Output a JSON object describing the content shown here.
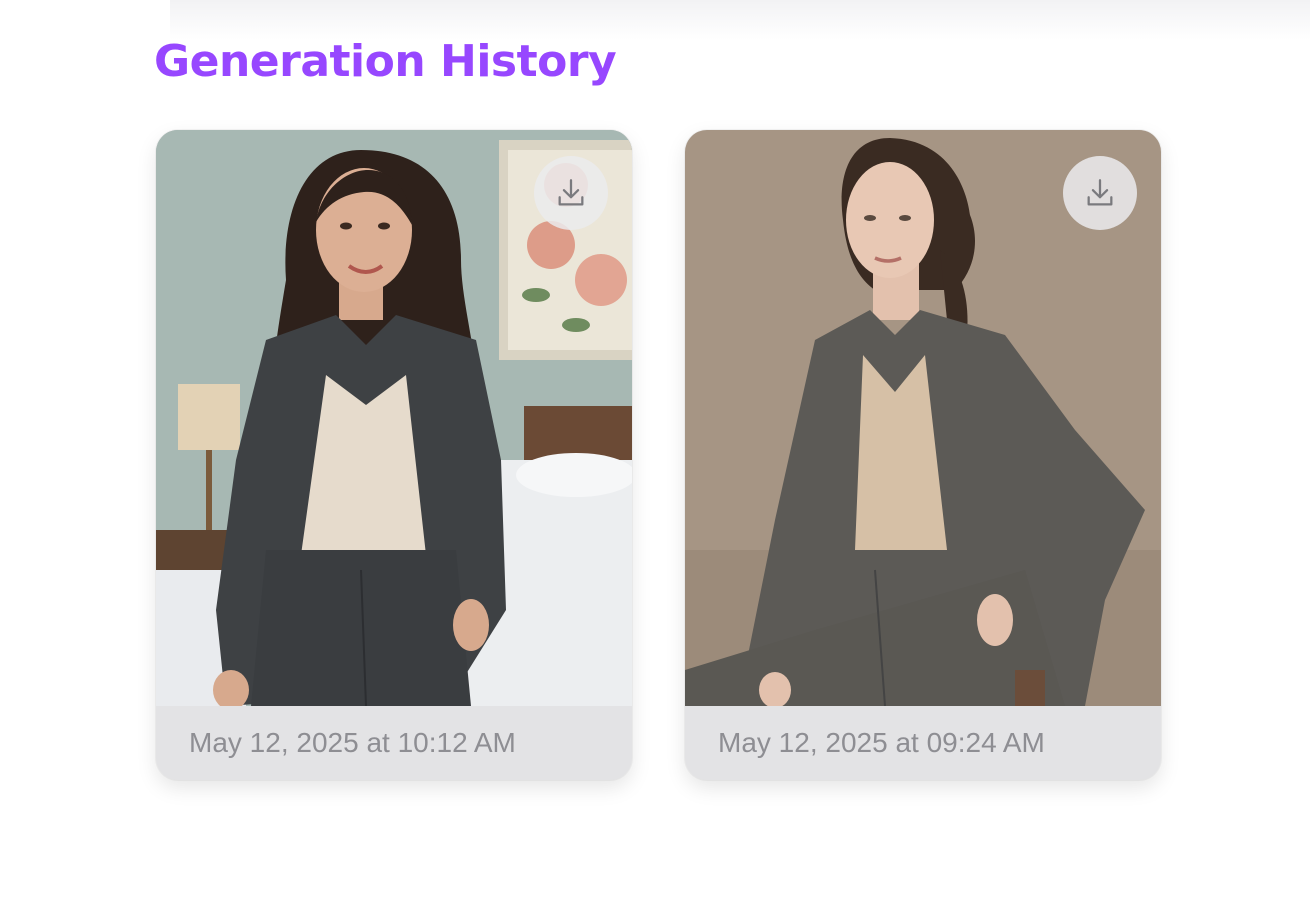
{
  "page": {
    "title": "Generation History",
    "accent": "#9747ff"
  },
  "history": [
    {
      "timestamp": "May 12, 2025 at 10:12 AM",
      "image": "woman in charcoal suit in bedroom",
      "download_icon": "download-icon"
    },
    {
      "timestamp": "May 12, 2025 at 09:24 AM",
      "image": "woman in grey suit seated on beige background",
      "download_icon": "download-icon"
    }
  ]
}
